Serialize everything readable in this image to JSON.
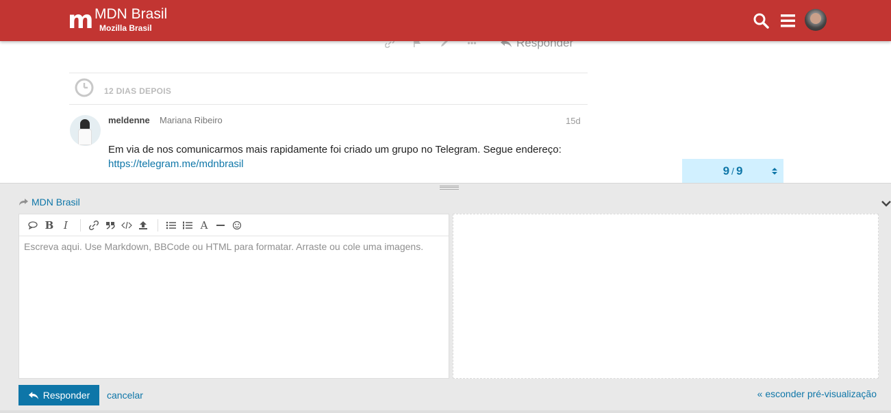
{
  "header": {
    "logo_letter": "m",
    "title": "MDN Brasil",
    "subtitle": "Mozilla Brasil",
    "icons": [
      "search-icon",
      "hamburger-menu-icon",
      "user-avatar"
    ]
  },
  "post_controls": {
    "icons": [
      "link-icon",
      "flag-icon",
      "edit-icon",
      "more-icon"
    ],
    "reply_label": "Responder"
  },
  "gap": {
    "label": "12 DIAS DEPOIS"
  },
  "post": {
    "username": "meldenne",
    "full_name": "Mariana Ribeiro",
    "age": "15d",
    "text": "Em via de nos comunicarmos mais rapidamente foi criado um grupo no Telegram. Segue endereço:",
    "link": "https://telegram.me/mdnbrasil"
  },
  "timeline": {
    "current": "9",
    "separator": "/",
    "total": "9"
  },
  "composer": {
    "reply_to": "MDN Brasil",
    "placeholder": "Escreva aqui. Use Markdown, BBCode ou HTML para formatar. Arraste ou cole uma imagens.",
    "toolbar": [
      "quote-icon",
      "bold-icon",
      "italic-icon",
      "link-icon",
      "blockquote-icon",
      "code-icon",
      "upload-icon",
      "bullet-list-icon",
      "numbered-list-icon",
      "heading-icon",
      "rule-icon",
      "emoji-icon"
    ],
    "reply_button": "Responder",
    "cancel": "cancelar",
    "hide_preview": "« esconder pré-visualização"
  },
  "colors": {
    "brand": "#c23532",
    "link": "#0e76a8",
    "timeline_bg": "#d1f0ff",
    "composer_bg": "#e9e9e9"
  }
}
